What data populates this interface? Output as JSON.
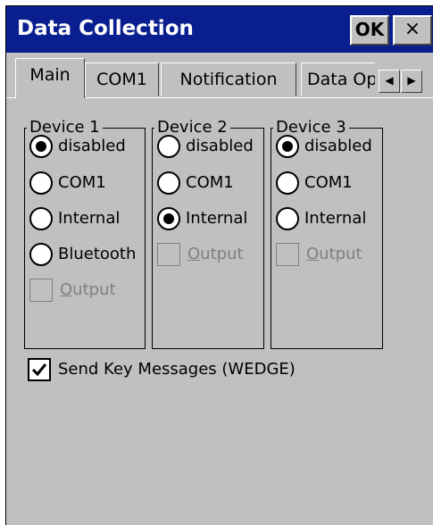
{
  "window": {
    "title": "Data Collection",
    "ok_label": "OK",
    "close_label": "×"
  },
  "tabs": [
    {
      "label": "Main",
      "active": true
    },
    {
      "label": "COM1",
      "active": false
    },
    {
      "label": "Notification",
      "active": false
    },
    {
      "label": "Data Options",
      "active": false
    }
  ],
  "tab_scroll": {
    "left": "◀",
    "right": "▶"
  },
  "devices": [
    {
      "label": "Device 1",
      "options": [
        "disabled",
        "COM1",
        "Internal",
        "Bluetooth"
      ],
      "selected": "disabled",
      "output": {
        "label": "Output",
        "access_key": "O",
        "rest": "utput",
        "checked": false,
        "enabled": false
      }
    },
    {
      "label": "Device 2",
      "options": [
        "disabled",
        "COM1",
        "Internal"
      ],
      "selected": "Internal",
      "output": {
        "label": "Output",
        "access_key": "O",
        "rest": "utput",
        "checked": false,
        "enabled": false
      }
    },
    {
      "label": "Device 3",
      "options": [
        "disabled",
        "COM1",
        "Internal"
      ],
      "selected": "disabled",
      "output": {
        "label": "Output",
        "access_key": "O",
        "rest": "utput",
        "checked": false,
        "enabled": false
      }
    }
  ],
  "wedge": {
    "label": "Send Key Messages (WEDGE)",
    "checked": true
  },
  "colors": {
    "titlebar": "#0a1f8f",
    "panel": "#c0c0c0",
    "disabled_text": "#808080"
  }
}
